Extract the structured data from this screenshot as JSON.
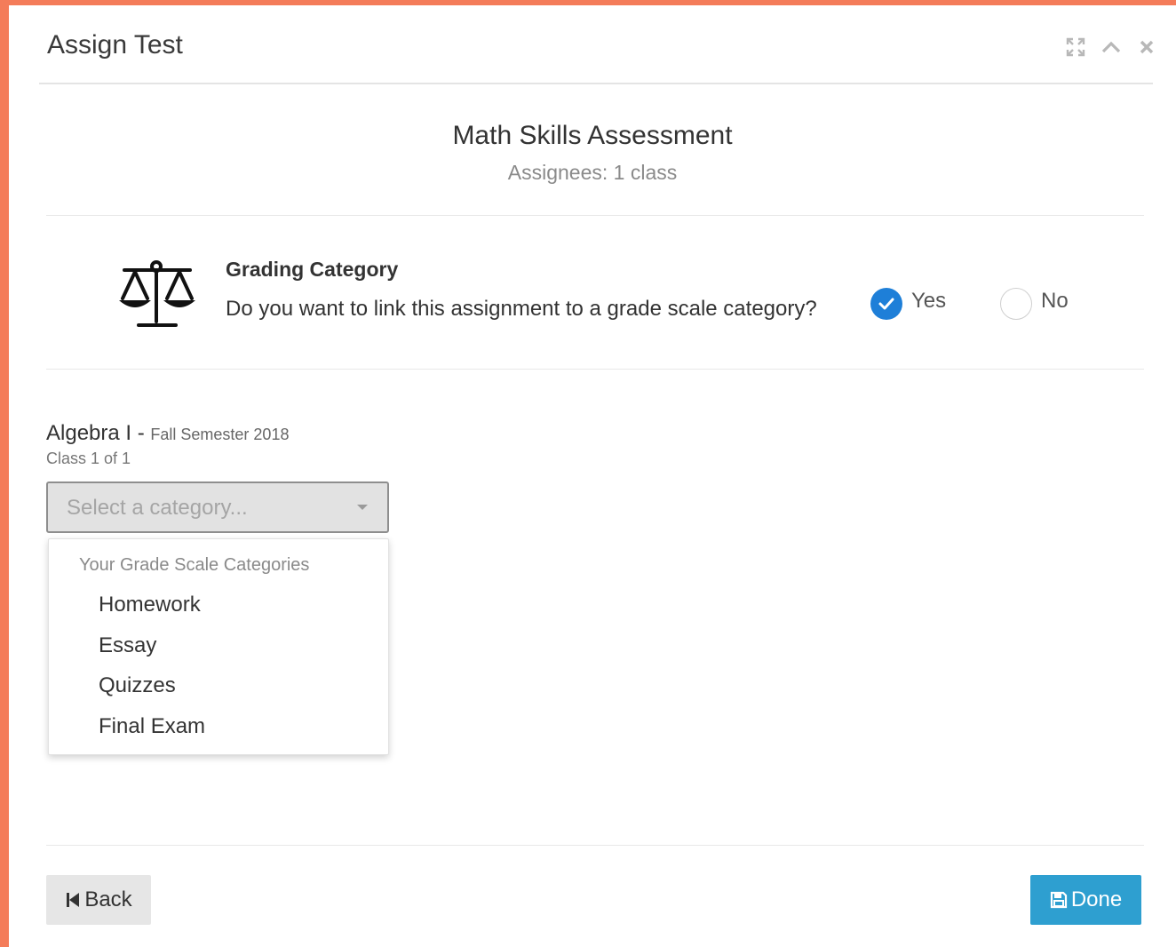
{
  "dialog": {
    "title": "Assign Test",
    "header_icons": [
      "expand-icon",
      "chevron-up-icon",
      "close-icon"
    ]
  },
  "test": {
    "name": "Math Skills Assessment",
    "assignees": "Assignees: 1 class"
  },
  "grading": {
    "title": "Grading Category",
    "question": "Do you want to link this assignment to a grade scale category?",
    "options": [
      {
        "label": "Yes",
        "selected": true
      },
      {
        "label": "No",
        "selected": false
      }
    ]
  },
  "class": {
    "name": "Algebra I - ",
    "term": "Fall Semester 2018",
    "count": "Class 1 of 1"
  },
  "category_select": {
    "placeholder": "Select a category...",
    "group_label": "Your Grade Scale Categories",
    "options": [
      "Homework",
      "Essay",
      "Quizzes",
      "Final Exam"
    ]
  },
  "footer": {
    "back_label": "Back",
    "done_label": "Done"
  },
  "colors": {
    "accent_border": "#f47c5a",
    "radio_checked": "#1e7fd8",
    "done_button": "#2e9fd0"
  }
}
